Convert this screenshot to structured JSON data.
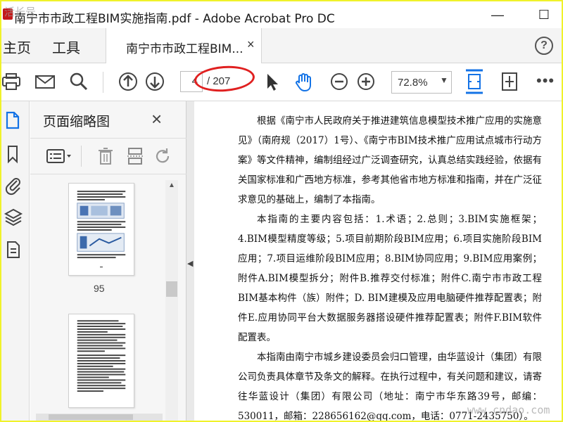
{
  "window": {
    "title": "南宁市市政工程BIM实施指南.pdf - Adobe Acrobat Pro DC",
    "minimize": "—",
    "maximize": "☐"
  },
  "menu": {
    "home": "主页",
    "tools": "工具",
    "tab_label": "南宁市市政工程BIM...",
    "tab_close": "×",
    "help": "?"
  },
  "toolbar": {
    "current_page": "4",
    "page_total": "/ 207",
    "zoom": "72.8%",
    "zoom_caret": "▼",
    "more": "•••",
    "annotation_color": "#e02020",
    "accent": "#1473e6"
  },
  "thumbnails_panel": {
    "title": "页面缩略图",
    "close": "×",
    "pages": [
      {
        "number": "95"
      },
      {
        "number": ""
      }
    ]
  },
  "document": {
    "paragraphs": [
      "根据《南宁市人民政府关于推进建筑信息模型技术推广应用的实施意见》（南府规（2017）1号）、《南宁市BIM技术推广应用试点城市行动方案》等文件精神，编制组经过广泛调查研究，认真总结实践经验，依据有关国家标准和广西地方标准，参考其他省市地方标准和指南，并在广泛征求意见的基础上，编制了本指南。",
      "本指南的主要内容包括：1.术语；2.总则；3.BIM实施框架；4.BIM模型精度等级；5.项目前期阶段BIM应用；6.项目实施阶段BIM应用；7.项目运维阶段BIM应用；8.BIM协同应用；9.BIM应用案例；附件A.BIM模型拆分；附件B.推荐交付标准；附件C.南宁市市政工程BIM基本构件（族）附件；D. BIM建模及应用电脑硬件推荐配置表；附件E.应用协同平台大数据服务器搭设硬件推荐配置表；附件F.BIM软件配置表。",
      "本指南由南宁市城乡建设委员会归口管理，由华蓝设计（集团）有限公司负责具体章节及条文的解释。在执行过程中，有关问题和建议，请寄往华蓝设计（集团）有限公司（地址：南宁市华东路39号，邮编：530011，邮箱：228656162@qq.com，电话：0771-2435750）。"
    ]
  },
  "watermarks": {
    "top_left": "活长号",
    "bottom_right": "www.cndao.com"
  }
}
